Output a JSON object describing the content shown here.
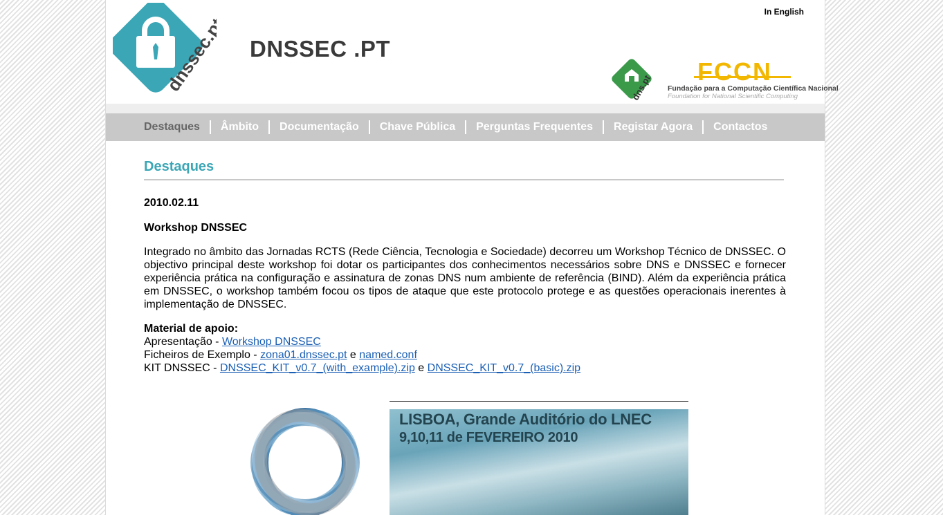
{
  "header": {
    "lang_link": "In English",
    "site_title": "DNSSEC .PT",
    "fccn_sub1": "Fundação para a Computação Científica Nacional",
    "fccn_sub2": "Foundation for National Scientific Computing",
    "logo_text": "dnssec.pt",
    "fccn_text": "FCCN",
    "dns_text": "dns.pt"
  },
  "nav": {
    "items": [
      {
        "label": "Destaques"
      },
      {
        "label": "Âmbito"
      },
      {
        "label": "Documentação"
      },
      {
        "label": "Chave Pública"
      },
      {
        "label": "Perguntas Frequentes"
      },
      {
        "label": "Registar Agora"
      },
      {
        "label": "Contactos"
      }
    ]
  },
  "content": {
    "section_title": "Destaques",
    "date": "2010.02.11",
    "headline": "Workshop DNSSEC",
    "body": "Integrado no âmbito das Jornadas RCTS (Rede Ciência, Tecnologia e Sociedade) decorreu um Workshop Técnico de DNSSEC. O objectivo principal deste workshop foi dotar os participantes dos conhecimentos necessários sobre DNS e DNSSEC e fornecer experiência prática na configuração e assinatura de zonas DNS num ambiente de referência (BIND). Além da experiência prática em DNSSEC, o workshop também focou os tipos de ataque que este protocolo protege e as questões operacionais inerentes à implementação de DNSSEC.",
    "material": {
      "title": "Material de apoio:",
      "presentation_prefix": "Apresentação - ",
      "presentation_link": "Workshop DNSSEC",
      "examples_prefix": "Ficheiros de Exemplo - ",
      "example_link1": "zona01.dnssec.pt",
      "conj": " e ",
      "example_link2": "named.conf",
      "kit_prefix": "KIT DNSSEC - ",
      "kit_link1": "DNSSEC_KIT_v0.7_(with_example).zip",
      "kit_link2": "DNSSEC_KIT_v0.7_(basic).zip"
    },
    "event": {
      "line1": "LISBOA, Grande Auditório do LNEC",
      "line2": "9,10,11 de FEVEREIRO 2010"
    }
  },
  "colors": {
    "accent": "#3aa6b6",
    "nav_bg": "#c8c8c8",
    "link": "#1a5fb4",
    "fccn_yellow": "#f2b700"
  }
}
